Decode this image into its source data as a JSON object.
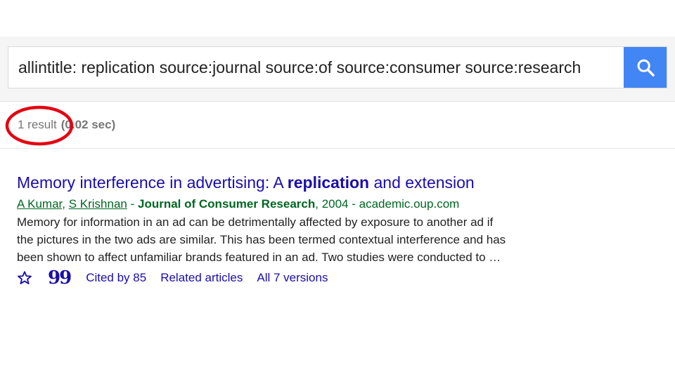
{
  "search": {
    "query": "allintitle: replication source:journal source:of source:consumer source:research"
  },
  "stats": {
    "count": "1 result",
    "time": "(0.02 sec)"
  },
  "result": {
    "title_before": "Memory interference in advertising: A ",
    "title_bold": "replication",
    "title_after": " and extension",
    "author1": "A Kumar",
    "author_sep": ", ",
    "author2": "S Krishnan",
    "dash1": " - ",
    "journal": "Journal of Consumer Research",
    "year_source": ", 2004 - academic.oup.com",
    "snippet_lines": [
      "Memory for information in an ad can be detrimentally affected by exposure to another ad if",
      "the pictures in the two ads are similar. This has been termed contextual interference and has",
      "been shown to affect unfamiliar brands featured in an ad. Two studies were conducted to …"
    ],
    "cited_by": "Cited by 85",
    "related": "Related articles",
    "versions": "All 7 versions"
  },
  "icons": {
    "search": "search-icon",
    "save": "star-icon",
    "cite": "quote-icon"
  },
  "colors": {
    "search_button": "#4285f4",
    "title_link": "#1a0dab",
    "meta_green": "#006621",
    "annotation_circle": "#e30613"
  }
}
